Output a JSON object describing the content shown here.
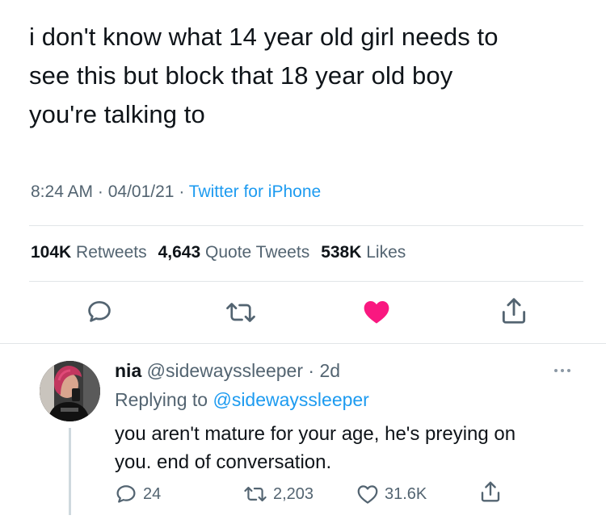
{
  "tweet": {
    "text_lines": [
      "i don't know what 14 year old girl needs to",
      "see this but block that 18 year old boy",
      "you're talking to"
    ],
    "time": "8:24 AM",
    "date": "04/01/21",
    "source": "Twitter for iPhone",
    "separator": " · ",
    "stats": {
      "retweets_count": "104K",
      "retweets_label": "Retweets",
      "quotes_count": "4,643",
      "quotes_label": "Quote Tweets",
      "likes_count": "538K",
      "likes_label": "Likes"
    },
    "liked": true,
    "colors": {
      "accent": "#1d9bf0",
      "like": "#f91880",
      "muted": "#536471"
    }
  },
  "reply": {
    "name": "nia",
    "handle": "@sidewayssleeper",
    "time_sep": " · ",
    "time": "2d",
    "replying_prefix": "Replying to",
    "replying_handle": "@sidewayssleeper",
    "text_lines": [
      "you aren't mature for your age, he's preying on",
      "you. end of conversation."
    ],
    "reply_count": "24",
    "retweet_count": "2,203",
    "like_count": "31.6K"
  }
}
